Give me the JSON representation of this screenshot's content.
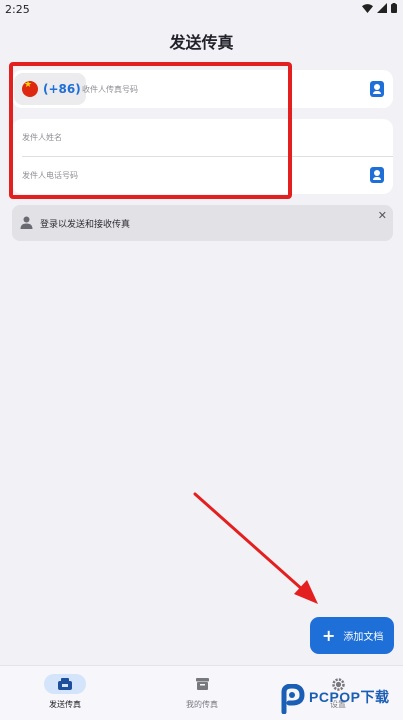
{
  "status_bar": {
    "time": "2:25"
  },
  "header": {
    "title": "发送传真"
  },
  "recipient": {
    "dial_code": "(+86)",
    "placeholder": "收件人传真号码"
  },
  "sender": {
    "name_placeholder": "发件人姓名",
    "phone_placeholder": "发件人电话号码"
  },
  "login_banner": {
    "text": "登录以发送和接收传真"
  },
  "fab": {
    "label": "添加文档"
  },
  "bottom_nav": {
    "items": [
      {
        "label": "发送传真",
        "icon": "fax-send-icon",
        "active": true
      },
      {
        "label": "我的传真",
        "icon": "archive-box-icon",
        "active": false
      },
      {
        "label": "设置",
        "icon": "gear-icon",
        "active": false
      }
    ]
  },
  "watermark": {
    "brand": "PCPOP下载"
  },
  "colors": {
    "accent": "#1e6fd8",
    "highlight": "#e41f1f",
    "background": "#f2f1f6"
  }
}
